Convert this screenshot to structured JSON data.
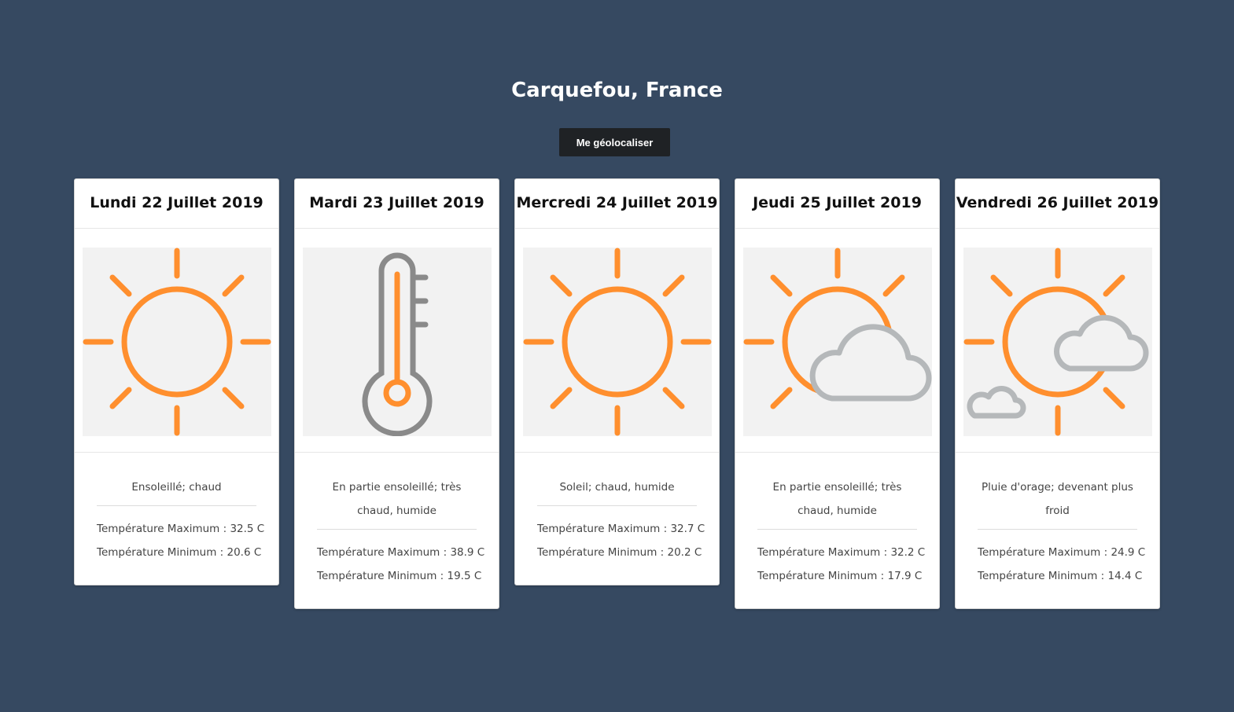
{
  "location": {
    "title": "Carquefou, France"
  },
  "geolocate_button": {
    "label": "Me géolocaliser"
  },
  "colors": {
    "background": "#364961",
    "sun": "#ff8f2e",
    "cloud": "#b5b8ba",
    "thermometer": "#8a8a8a",
    "button": "#1f2225"
  },
  "forecast": [
    {
      "date": "Lundi 22 Juillet 2019",
      "icon": "sun-icon",
      "description": "Ensoleillé; chaud",
      "temp_max": "Température Maximum : 32.5 C",
      "temp_min": "Température Minimum : 20.6 C"
    },
    {
      "date": "Mardi 23 Juillet 2019",
      "icon": "thermometer-icon",
      "description": "En partie ensoleillé; très chaud, humide",
      "temp_max": "Température Maximum : 38.9 C",
      "temp_min": "Température Minimum : 19.5 C"
    },
    {
      "date": "Mercredi 24 Juillet 2019",
      "icon": "sun-icon",
      "description": "Soleil; chaud, humide",
      "temp_max": "Température Maximum : 32.7 C",
      "temp_min": "Température Minimum : 20.2 C"
    },
    {
      "date": "Jeudi 25 Juillet 2019",
      "icon": "sun-cloud-icon",
      "description": "En partie ensoleillé; très chaud, humide",
      "temp_max": "Température Maximum : 32.2 C",
      "temp_min": "Température Minimum : 17.9 C"
    },
    {
      "date": "Vendredi 26 Juillet 2019",
      "icon": "sun-clouds-icon",
      "description": "Pluie d'orage; devenant plus froid",
      "temp_max": "Température Maximum : 24.9 C",
      "temp_min": "Température Minimum : 14.4 C"
    }
  ]
}
